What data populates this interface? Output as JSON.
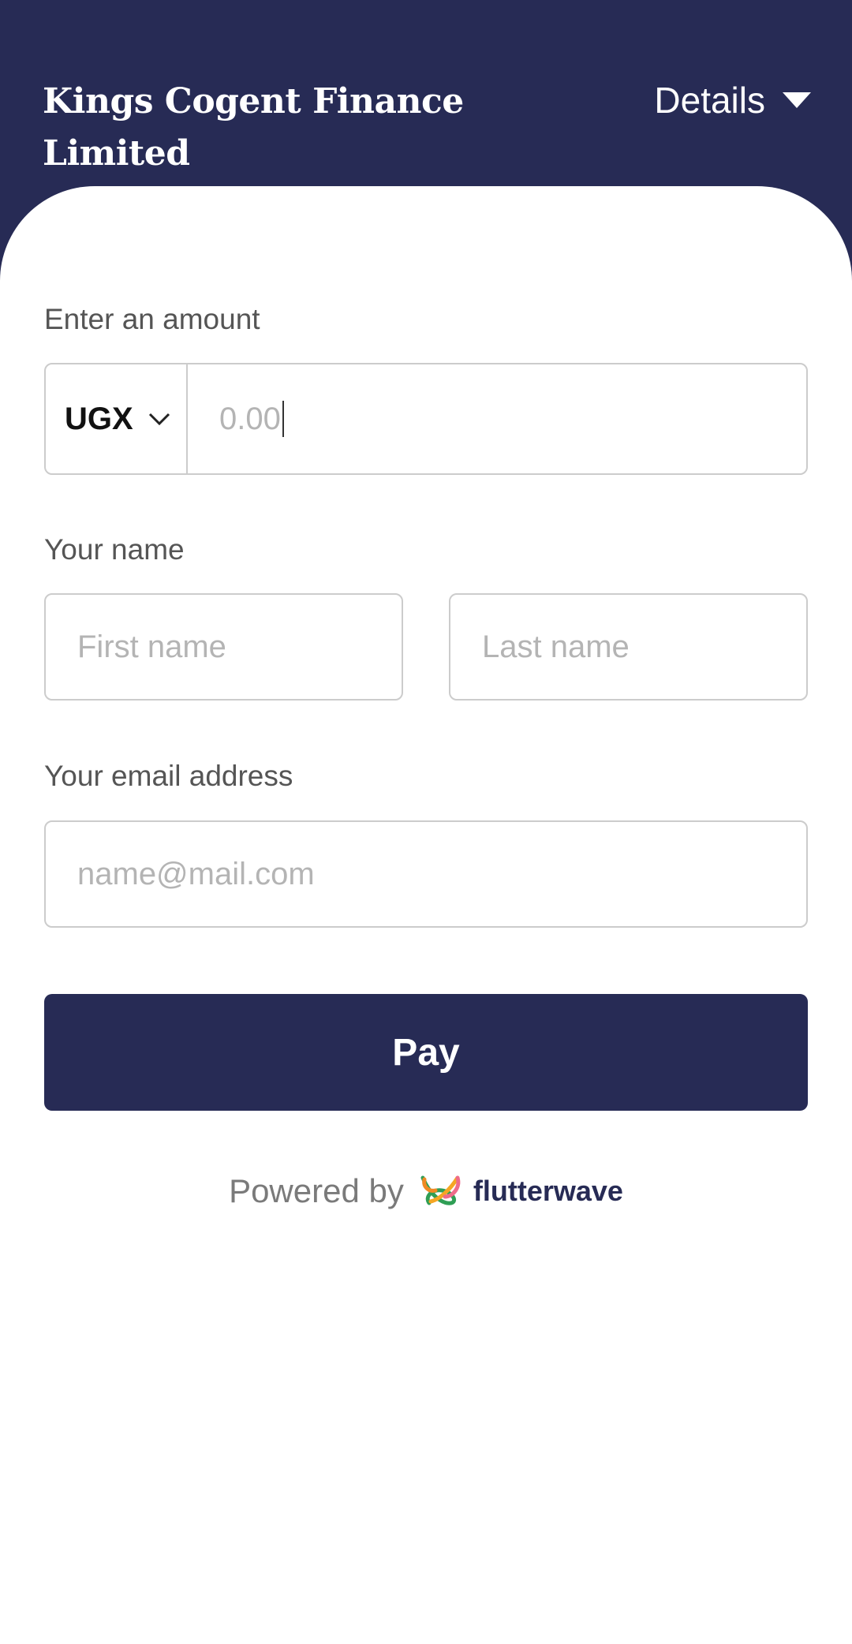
{
  "header": {
    "merchant_name": "Kings Cogent Finance Limited",
    "details_label": "Details"
  },
  "amount": {
    "label": "Enter an amount",
    "currency": "UGX",
    "placeholder": "0.00"
  },
  "name": {
    "label": "Your name",
    "first_placeholder": "First name",
    "last_placeholder": "Last name"
  },
  "email": {
    "label": "Your email address",
    "placeholder": "name@mail.com"
  },
  "pay_button": {
    "label": "Pay"
  },
  "footer": {
    "powered_by": "Powered by",
    "brand": "flutterwave",
    "logo_icon": "flutterwave-logo-icon"
  },
  "colors": {
    "primary": "#272b55",
    "border": "#cccccc",
    "placeholder": "#b4b4b4",
    "label": "#555555"
  }
}
